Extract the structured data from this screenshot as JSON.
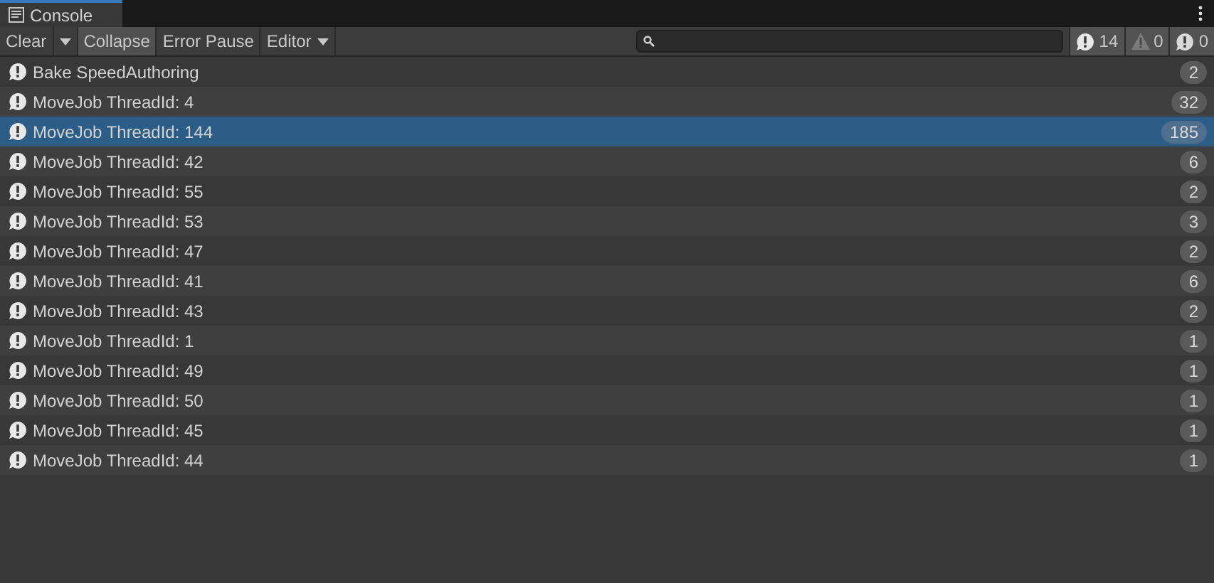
{
  "window": {
    "title": "Console"
  },
  "toolbar": {
    "buttons": [
      {
        "kind": "split",
        "label": "Clear",
        "on": false
      },
      {
        "kind": "toggle",
        "label": "Collapse",
        "on": true
      },
      {
        "kind": "toggle",
        "label": "Error Pause",
        "on": false
      },
      {
        "kind": "dropdown",
        "label": "Editor",
        "on": false
      }
    ],
    "counters": [
      {
        "kind": "info",
        "count": "14",
        "on": true
      },
      {
        "kind": "warning",
        "count": "0",
        "on": true
      },
      {
        "kind": "error",
        "count": "0",
        "on": true
      }
    ]
  },
  "entries": [
    {
      "message": "Bake SpeedAuthoring",
      "count": "2",
      "selected": false
    },
    {
      "message": "MoveJob ThreadId: 4",
      "count": "32",
      "selected": false
    },
    {
      "message": "MoveJob ThreadId: 144",
      "count": "185",
      "selected": true
    },
    {
      "message": "MoveJob ThreadId: 42",
      "count": "6",
      "selected": false
    },
    {
      "message": "MoveJob ThreadId: 55",
      "count": "2",
      "selected": false
    },
    {
      "message": "MoveJob ThreadId: 53",
      "count": "3",
      "selected": false
    },
    {
      "message": "MoveJob ThreadId: 47",
      "count": "2",
      "selected": false
    },
    {
      "message": "MoveJob ThreadId: 41",
      "count": "6",
      "selected": false
    },
    {
      "message": "MoveJob ThreadId: 43",
      "count": "2",
      "selected": false
    },
    {
      "message": "MoveJob ThreadId: 1",
      "count": "1",
      "selected": false
    },
    {
      "message": "MoveJob ThreadId: 49",
      "count": "1",
      "selected": false
    },
    {
      "message": "MoveJob ThreadId: 50",
      "count": "1",
      "selected": false
    },
    {
      "message": "MoveJob ThreadId: 45",
      "count": "1",
      "selected": false
    },
    {
      "message": "MoveJob ThreadId: 44",
      "count": "1",
      "selected": false
    }
  ]
}
